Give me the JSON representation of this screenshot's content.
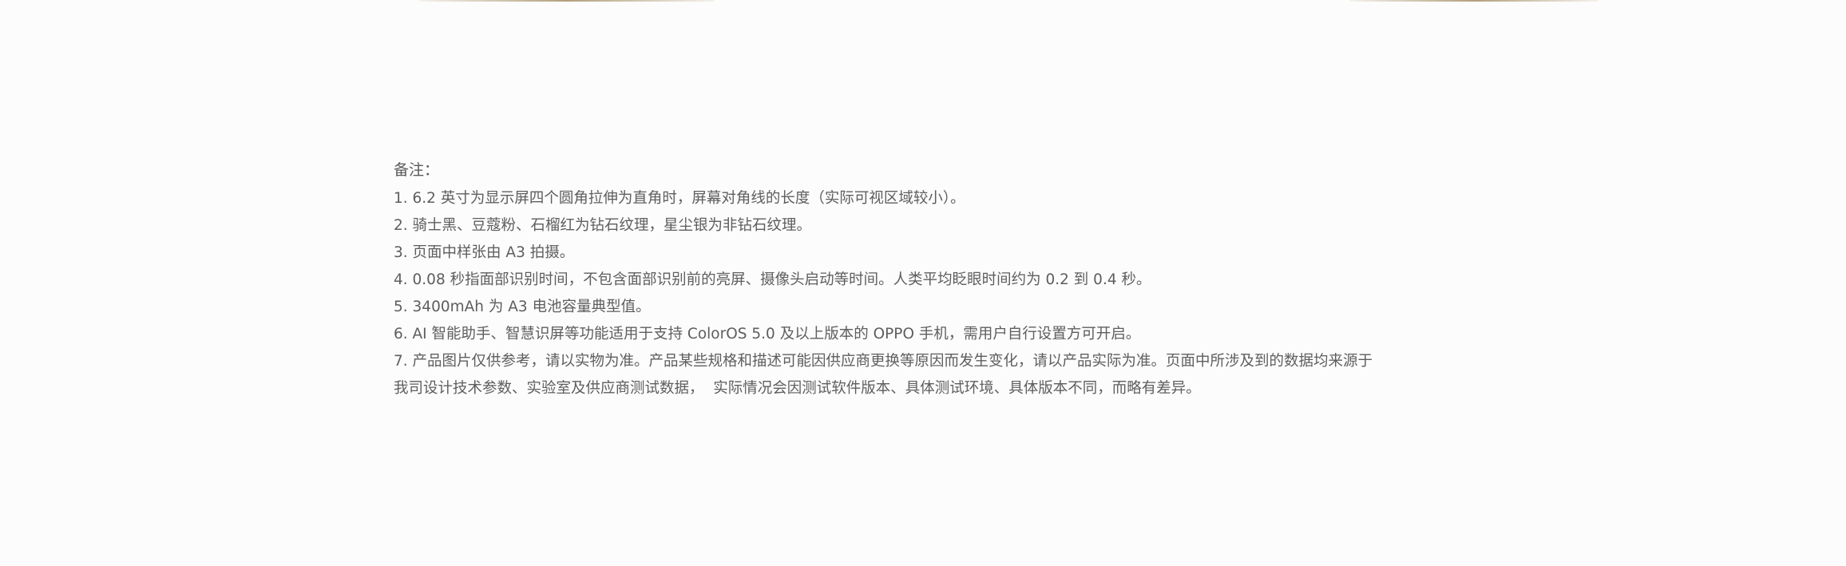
{
  "notes": {
    "title": "备注：",
    "items": [
      "1. 6.2 英寸为显示屏四个圆角拉伸为直角时，屏幕对角线的长度（实际可视区域较小）。",
      "2. 骑士黑、豆蔻粉、石榴红为钻石纹理，星尘银为非钻石纹理。",
      "3. 页面中样张由 A3 拍摄。",
      "4. 0.08 秒指面部识别时间，不包含面部识别前的亮屏、摄像头启动等时间。人类平均眨眼时间约为 0.2 到 0.4 秒。",
      "5. 3400mAh 为 A3 电池容量典型值。",
      "6. AI 智能助手、智慧识屏等功能适用于支持 ColorOS 5.0 及以上版本的 OPPO 手机，需用户自行设置方可开启。",
      "7. 产品图片仅供参考，请以实物为准。产品某些规格和描述可能因供应商更换等原因而发生变化，请以产品实际为准。页面中所涉及到的数据均来源于",
      "我司设计技术参数、实验室及供应商测试数据，  实际情况会因测试软件版本、具体测试环境、具体版本不同，而略有差异。"
    ]
  }
}
